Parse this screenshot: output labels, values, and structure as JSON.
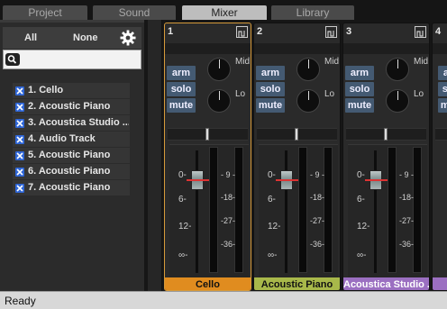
{
  "tabs": [
    {
      "label": "Project",
      "active": false
    },
    {
      "label": "Sound",
      "active": false
    },
    {
      "label": "Mixer",
      "active": true
    },
    {
      "label": "Library",
      "active": false
    }
  ],
  "left_panel": {
    "all_label": "All",
    "none_label": "None",
    "settings_icon": "gear-icon",
    "search": {
      "value": "",
      "placeholder": ""
    },
    "tracks": [
      {
        "label": "1. Cello",
        "checked": true
      },
      {
        "label": "2. Acoustic Piano",
        "checked": true
      },
      {
        "label": "3. Acoustica Studio ...",
        "checked": true
      },
      {
        "label": "4. Audio Track",
        "checked": true
      },
      {
        "label": "5. Acoustic Piano",
        "checked": true
      },
      {
        "label": "6. Acoustic Piano",
        "checked": true
      },
      {
        "label": "7. Acoustic Piano",
        "checked": true
      }
    ]
  },
  "mixer": {
    "eq_labels": {
      "mid": "Mid",
      "lo": "Lo"
    },
    "buttons": {
      "arm": "arm",
      "solo": "solo",
      "mute": "mute"
    },
    "fader_scale": [
      "0-",
      "6-",
      "12-",
      "∞-"
    ],
    "meter_scale": [
      "- 9 -",
      "-18-",
      "-27-",
      "-36-"
    ],
    "strips": [
      {
        "number": "1",
        "name": "Cello",
        "color": "#e08c1f",
        "selected": true
      },
      {
        "number": "2",
        "name": "Acoustic Piano",
        "color": "#a8b84a",
        "selected": false
      },
      {
        "number": "3",
        "name": "Acoustica Studio ...",
        "color": "#9b6fc1",
        "selected": false
      },
      {
        "number": "4",
        "name": "",
        "color": "#9b6fc1",
        "selected": false
      }
    ]
  },
  "status": {
    "text": "Ready"
  }
}
